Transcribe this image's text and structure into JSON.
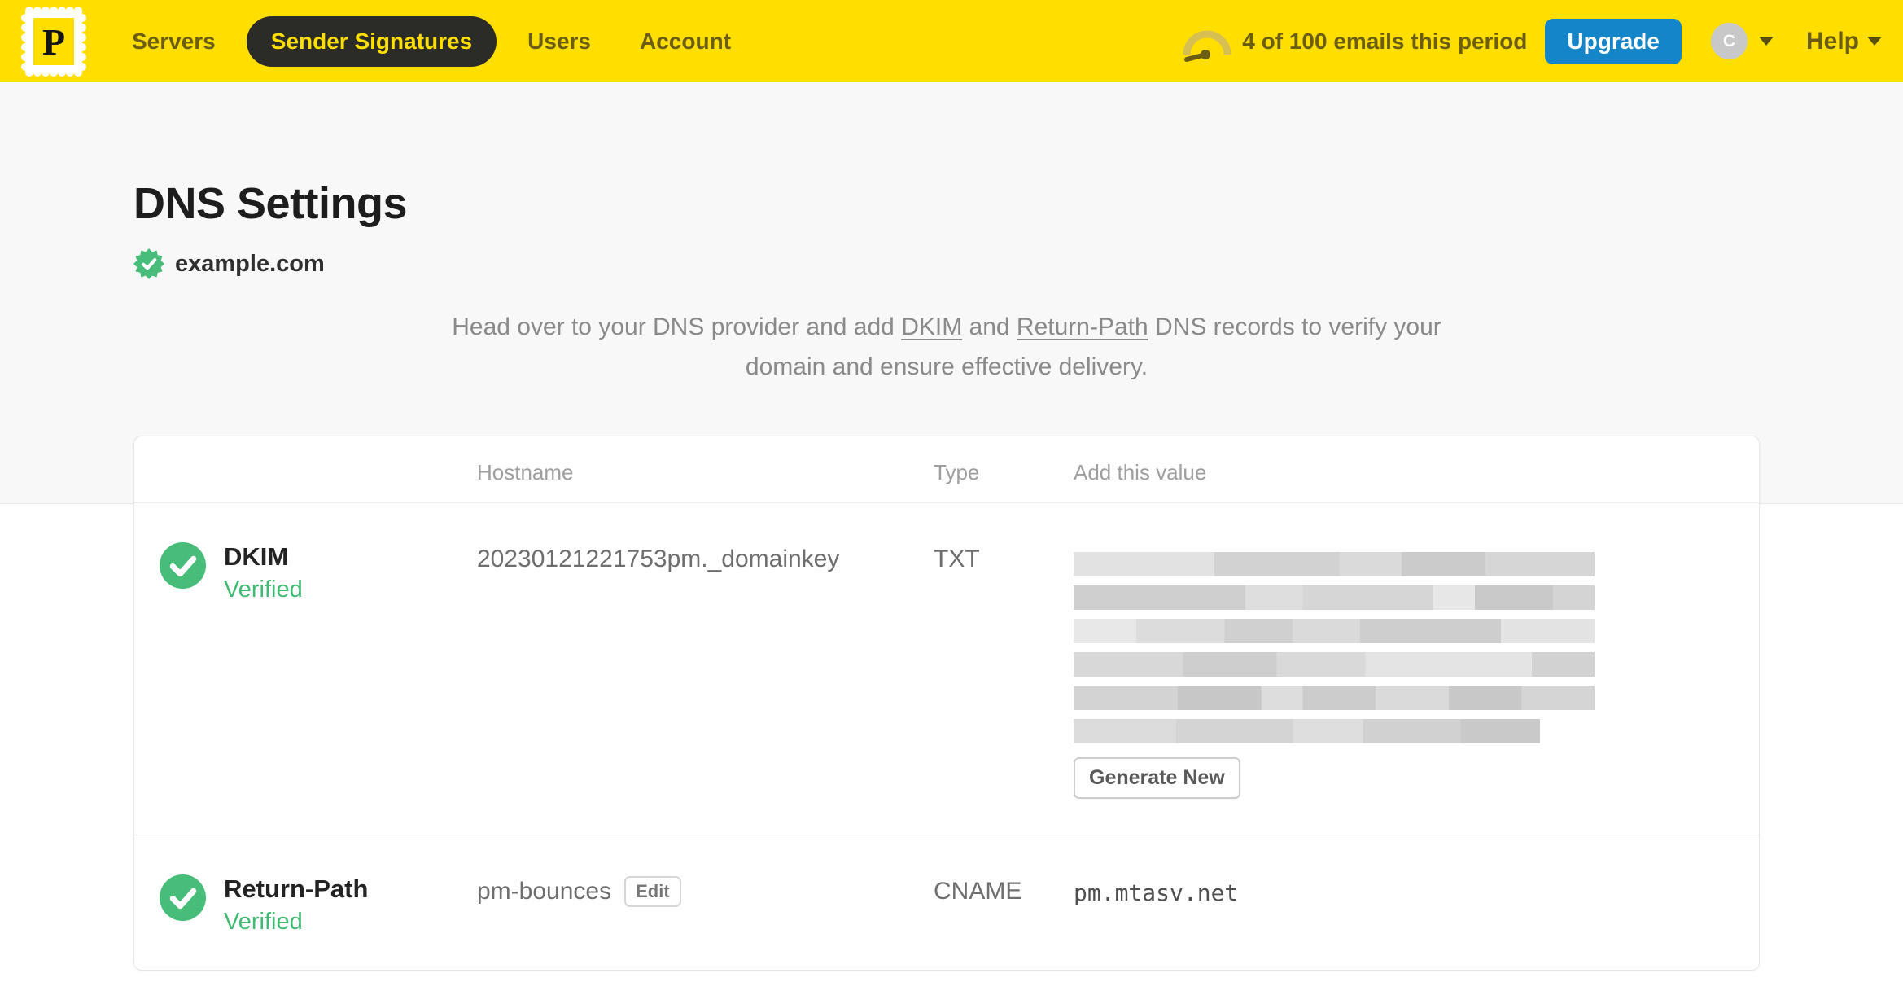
{
  "colors": {
    "brand_yellow": "#ffde00",
    "nav_text_olive": "#6b5e12",
    "active_pill_bg": "#2b2b28",
    "upgrade_blue": "#1585c9",
    "verified_green": "#47bd79",
    "muted_text_gray": "#8a8a8a"
  },
  "nav": {
    "logo_letter": "P",
    "items": [
      {
        "label": "Servers"
      },
      {
        "label": "Sender Signatures"
      },
      {
        "label": "Users"
      },
      {
        "label": "Account"
      }
    ],
    "usage_text": "4 of 100 emails this period",
    "upgrade_label": "Upgrade",
    "avatar_initial": "C",
    "help_label": "Help"
  },
  "page": {
    "title": "DNS Settings",
    "domain": "example.com",
    "description": {
      "part1": "Head over to your DNS provider and add ",
      "link1": "DKIM",
      "part2": " and ",
      "link2": "Return-Path",
      "part3": " DNS records to verify your domain and ensure effective delivery."
    }
  },
  "table": {
    "headers": {
      "hostname": "Hostname",
      "type": "Type",
      "value": "Add this value"
    },
    "rows": [
      {
        "name": "DKIM",
        "status": "Verified",
        "hostname": "20230121221753pm._domainkey",
        "type": "TXT",
        "value_redacted": true,
        "action_label": "Generate New"
      },
      {
        "name": "Return-Path",
        "status": "Verified",
        "hostname": "pm-bounces",
        "edit_label": "Edit",
        "type": "CNAME",
        "value": "pm.mtasv.net"
      }
    ]
  }
}
